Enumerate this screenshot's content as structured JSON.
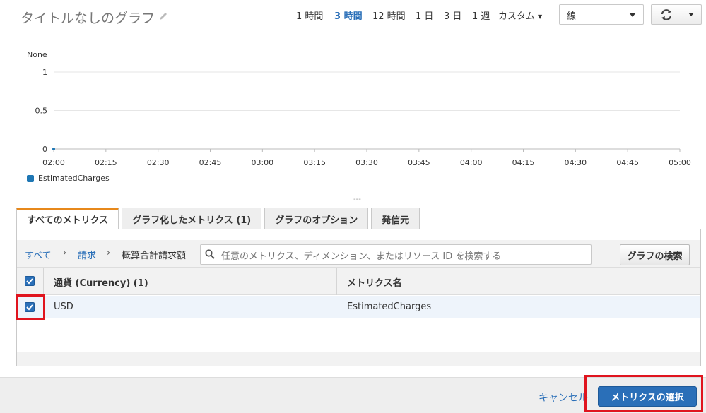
{
  "header": {
    "title": "タイトルなしのグラフ",
    "ranges": [
      {
        "label": "1 時間",
        "active": false
      },
      {
        "label": "3 時間",
        "active": true
      },
      {
        "label": "12 時間",
        "active": false
      },
      {
        "label": "1 日",
        "active": false
      },
      {
        "label": "3 日",
        "active": false
      },
      {
        "label": "1 週",
        "active": false
      }
    ],
    "custom_label": "カスタム",
    "chart_type_value": "線"
  },
  "chart_data": {
    "type": "line",
    "ylabel": "None",
    "ylim": [
      0,
      1
    ],
    "yticks": [
      "1",
      "0.5",
      "0"
    ],
    "x": [
      "02:00",
      "02:15",
      "02:30",
      "02:45",
      "03:00",
      "03:15",
      "03:30",
      "03:45",
      "04:00",
      "04:15",
      "04:30",
      "04:45",
      "05:00"
    ],
    "series": [
      {
        "name": "EstimatedCharges",
        "color": "#1f77b4",
        "values": [
          0
        ]
      }
    ],
    "legend": "bottom-left",
    "grid": true
  },
  "divider_dots": "---",
  "tabs": [
    {
      "label": "すべてのメトリクス",
      "active": true
    },
    {
      "label": "グラフ化したメトリクス (1)",
      "active": false
    },
    {
      "label": "グラフのオプション",
      "active": false
    },
    {
      "label": "発信元",
      "active": false
    }
  ],
  "breadcrumb": {
    "all": "すべて",
    "billing": "請求",
    "current": "概算合計請求額",
    "sep": "›"
  },
  "search": {
    "placeholder": "任意のメトリクス、ディメンション、またはリソース ID を検索する"
  },
  "graph_search_label": "グラフの検索",
  "table": {
    "headers": {
      "currency": "通貨 (Currency) (1)",
      "metric": "メトリクス名"
    },
    "rows": [
      {
        "currency": "USD",
        "metric": "EstimatedCharges",
        "checked": true
      }
    ]
  },
  "footer": {
    "cancel_label": "キャンセル",
    "select_label": "メトリクスの選択"
  }
}
